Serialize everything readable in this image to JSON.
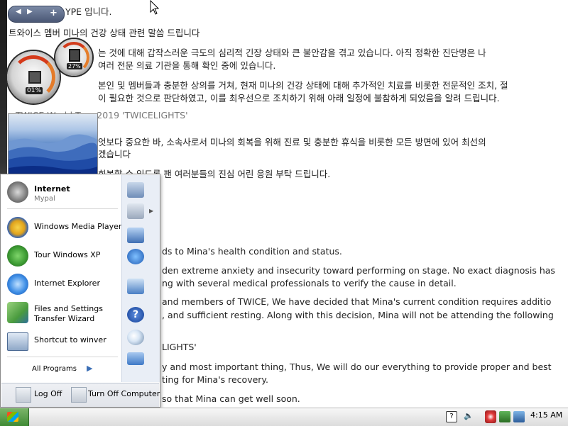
{
  "article": {
    "korean": [
      "트와이스 멤버 미나의 건강 상태 관련 말씀 드립니다",
      "는 것에 대해 갑작스러운 극도의 심리적 긴장 상태와 큰 불안감을 겪고 있습니다. 아직 정확한 진단명은 나",
      "여러 전문 의료 기관을 통해 확인 중에 있습니다.",
      "본인 및 멤버들과 충분한 상의를 거쳐, 현재 미나의 건강 상태에 대해 추가적인 치료를 비롯한 전문적인 조치, 절",
      "이 필요한 것으로 판단하였고, 이를 최우선으로 조치하기 위해 아래 일정에 불참하게 되었음을 알려 드립니다.",
      "TWICE World Tour 2019 'TWICELIGHTS'",
      "엇보다 중요한 바, 소속사로서 미나의 회복을 위해 진료 및 충분한 휴식을 비롯한 모든 방면에 있어 최선의",
      "겠습니다",
      "회복할 수 있도록 팬 여러분들의 진심 어린 응원 부탁 드립니다."
    ],
    "header_partial": "YPE 입니다.",
    "english": [
      "ds to Mina's health condition and status.",
      "den extreme anxiety and insecurity toward performing on stage. No exact diagnosis has",
      "ng with several medical professionals to verify the cause in detail.",
      "and members of TWICE, We have decided that Mina's current condition requires additio",
      ", and sufficient resting. Along with this decision, Mina will not be attending the following",
      "LIGHTS'",
      "y and most important thing, Thus, We will do our everything to provide proper and best",
      "ting for Mina's recovery.",
      "so that Mina can get well soon."
    ]
  },
  "gadgets": {
    "toolbar_add": "+",
    "cpu_meter_value": "01%",
    "ram_meter_value": "27%"
  },
  "start_menu": {
    "pinned": [
      {
        "label": "Internet",
        "sub": "Mypal",
        "icon": "raccoon-browser-icon"
      }
    ],
    "recent": [
      {
        "label": "Windows Media Player",
        "icon": "media-player-icon"
      },
      {
        "label": "Tour Windows XP",
        "icon": "tour-xp-icon"
      },
      {
        "label": "Internet Explorer",
        "icon": "internet-explorer-icon"
      },
      {
        "label": "Files and Settings",
        "label2": "Transfer Wizard",
        "icon": "transfer-wizard-icon"
      },
      {
        "label": "Shortcut to winver",
        "icon": "winver-icon"
      }
    ],
    "all_programs": "All Programs",
    "log_off": "Log Off",
    "turn_off": "Turn Off Computer"
  },
  "taskbar": {
    "clock": "4:15 AM"
  },
  "colors": {
    "taskbar_bg": "#e8e8e8",
    "start_green": "#4f9a3f",
    "sidebar_blue": "#1e49a3"
  }
}
